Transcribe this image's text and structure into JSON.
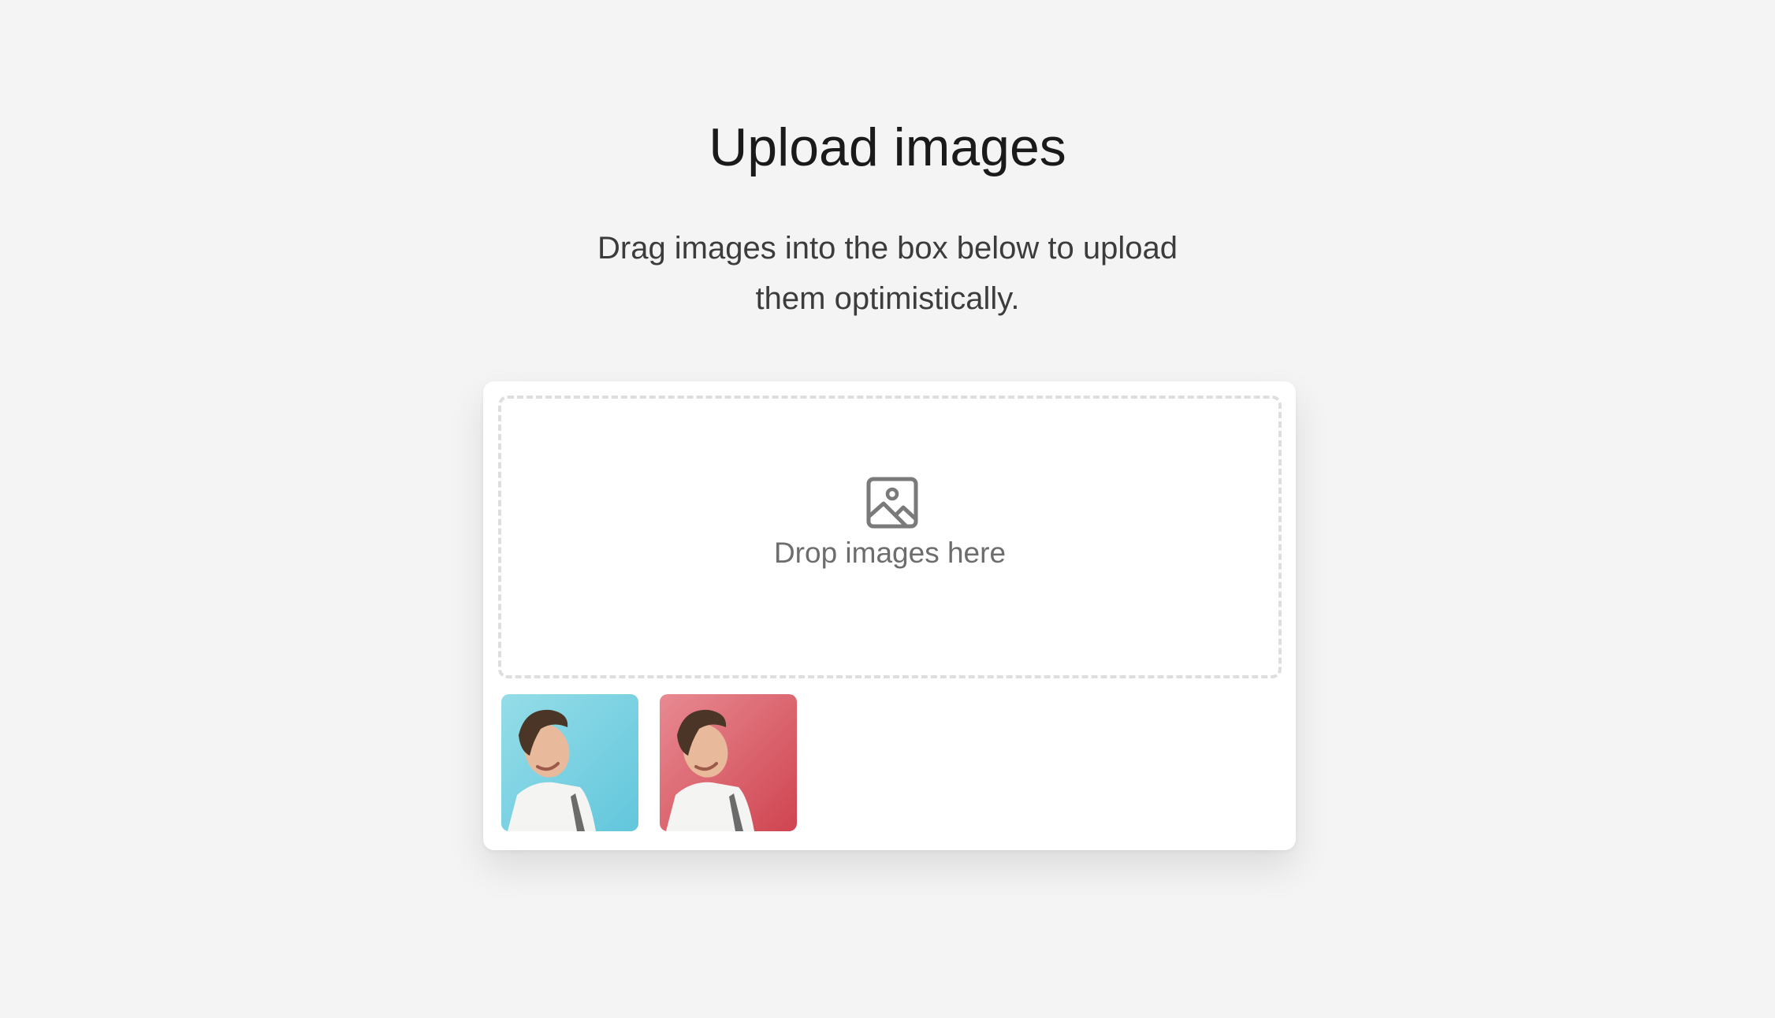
{
  "header": {
    "title": "Upload images",
    "subtitle": "Drag images into the box below to upload them optimistically."
  },
  "dropzone": {
    "label": "Drop images here",
    "icon": "image-icon"
  },
  "thumbnails": [
    {
      "name": "uploaded-image-1",
      "background": "#7dd3e3"
    },
    {
      "name": "uploaded-image-2",
      "background": "#d9535f"
    }
  ],
  "colors": {
    "page_background": "#f4f4f4",
    "card_background": "#ffffff",
    "dropzone_border": "#dedede",
    "icon_color": "#7a7a7a"
  }
}
